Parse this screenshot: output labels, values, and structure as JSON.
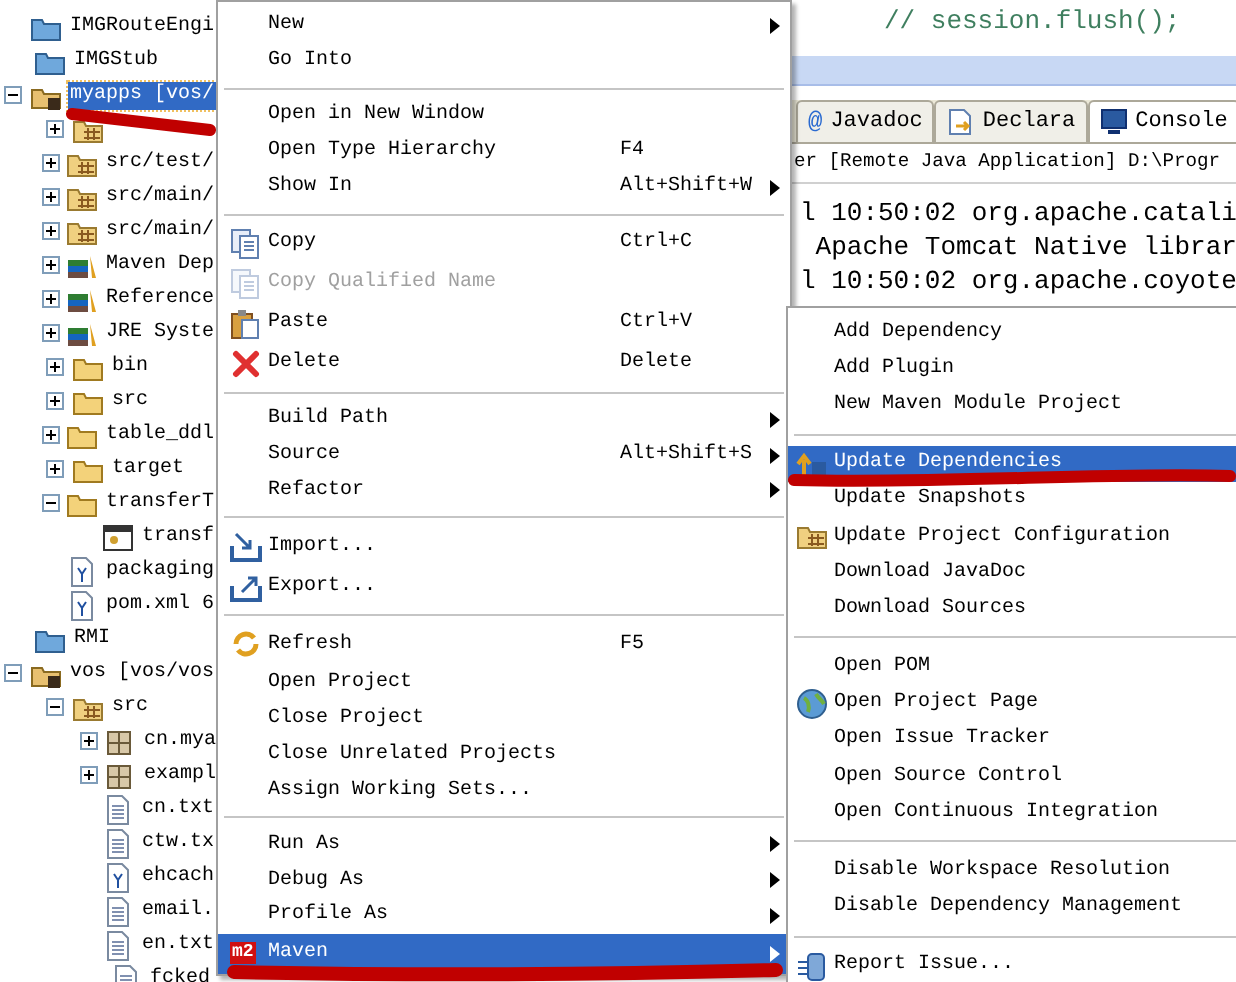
{
  "editor": {
    "code_line": "// session.flush();"
  },
  "console_view": {
    "tabs": [
      {
        "icon_char": "@",
        "label": "Javadoc",
        "kind": "javadoc",
        "selected": false
      },
      {
        "label": "Declara",
        "kind": "declaration",
        "selected": false
      },
      {
        "label": "Console",
        "kind": "console",
        "selected": true
      }
    ],
    "header": "er [Remote Java Application] D:\\Progr",
    "lines": [
      "l 10:50:02 org.apache.catali",
      " Apache Tomcat Native librar",
      "l 10:50:02 org.apache.coyote"
    ]
  },
  "tree": [
    {
      "label": "IMGRouteEngi",
      "kind": "project",
      "selected": false
    },
    {
      "label": "IMGStub",
      "kind": "project",
      "selected": false
    },
    {
      "label": "myapps [vos/",
      "kind": "maven-project",
      "selected": true,
      "expanded": true,
      "children": [
        {
          "kind": "package-folder",
          "selected": false,
          "expanded": false
        },
        {
          "label": "src/test/",
          "kind": "package-folder",
          "selected": false,
          "expanded": false
        },
        {
          "label": "src/main/",
          "kind": "package-folder",
          "selected": false,
          "expanded": false
        },
        {
          "label": "src/main/",
          "kind": "package-folder",
          "selected": false,
          "expanded": false
        },
        {
          "label": "Maven Dep",
          "kind": "library",
          "selected": false,
          "expanded": false
        },
        {
          "label": "Reference",
          "kind": "library",
          "selected": false,
          "expanded": false
        },
        {
          "label": "JRE Syste",
          "kind": "library",
          "selected": false,
          "expanded": false
        },
        {
          "label": "bin",
          "kind": "folder",
          "selected": false,
          "expanded": false
        },
        {
          "label": "src",
          "kind": "folder",
          "selected": false,
          "expanded": false
        },
        {
          "label": "table_ddl",
          "kind": "folder",
          "selected": false,
          "expanded": false
        },
        {
          "label": "target",
          "kind": "folder",
          "selected": false,
          "expanded": false
        },
        {
          "label": "transferT",
          "kind": "folder",
          "selected": false,
          "expanded": true,
          "children": [
            {
              "label": "transf",
              "kind": "window-file",
              "selected": false
            }
          ]
        },
        {
          "label": "packaging",
          "kind": "xml-file",
          "selected": false
        },
        {
          "label": "pom.xml 6",
          "kind": "xml-file",
          "selected": false
        }
      ]
    },
    {
      "label": "RMI",
      "kind": "project",
      "selected": false
    },
    {
      "label": "vos [vos/vos",
      "kind": "maven-project",
      "selected": false,
      "expanded": true,
      "children": [
        {
          "label": "src",
          "kind": "package-folder",
          "selected": false,
          "expanded": true,
          "children": [
            {
              "label": "cn.mya",
              "kind": "package",
              "selected": false,
              "expanded": false
            },
            {
              "label": "exampl",
              "kind": "package",
              "selected": false,
              "expanded": false
            },
            {
              "label": "cn.txt",
              "kind": "file",
              "selected": false
            },
            {
              "label": "ctw.tx",
              "kind": "file",
              "selected": false
            },
            {
              "label": "ehcach",
              "kind": "xml-file",
              "selected": false
            },
            {
              "label": "email.",
              "kind": "file",
              "selected": false
            },
            {
              "label": "en.txt",
              "kind": "file",
              "selected": false
            },
            {
              "label": "fcked",
              "kind": "file",
              "selected": false
            }
          ]
        }
      ]
    }
  ],
  "context_menu": {
    "groups": [
      [
        {
          "label": "New",
          "selected": false,
          "disabled": false,
          "submenu": true
        },
        {
          "label": "Go Into",
          "selected": false,
          "disabled": false,
          "submenu": false
        }
      ],
      [
        {
          "label": "Open in New Window",
          "selected": false,
          "disabled": false,
          "submenu": false
        },
        {
          "label": "Open Type Hierarchy",
          "shortcut": "F4",
          "selected": false,
          "disabled": false,
          "submenu": false
        },
        {
          "label": "Show In",
          "shortcut": "Alt+Shift+W",
          "selected": false,
          "disabled": false,
          "submenu": true
        }
      ],
      [
        {
          "label": "Copy",
          "kind": "copy",
          "shortcut": "Ctrl+C",
          "selected": false,
          "disabled": false,
          "submenu": false
        },
        {
          "label": "Copy Qualified Name",
          "kind": "copy",
          "selected": false,
          "disabled": true,
          "submenu": false
        },
        {
          "label": "Paste",
          "kind": "paste",
          "shortcut": "Ctrl+V",
          "selected": false,
          "disabled": false,
          "submenu": false
        },
        {
          "label": "Delete",
          "kind": "delete",
          "shortcut": "Delete",
          "selected": false,
          "disabled": false,
          "submenu": false
        }
      ],
      [
        {
          "label": "Build Path",
          "selected": false,
          "disabled": false,
          "submenu": true
        },
        {
          "label": "Source",
          "shortcut": "Alt+Shift+S",
          "selected": false,
          "disabled": false,
          "submenu": true
        },
        {
          "label": "Refactor",
          "selected": false,
          "disabled": false,
          "submenu": true
        }
      ],
      [
        {
          "label": "Import...",
          "kind": "import",
          "selected": false,
          "disabled": false,
          "submenu": false
        },
        {
          "label": "Export...",
          "kind": "export",
          "selected": false,
          "disabled": false,
          "submenu": false
        }
      ],
      [
        {
          "label": "Refresh",
          "kind": "refresh",
          "shortcut": "F5",
          "selected": false,
          "disabled": false,
          "submenu": false
        },
        {
          "label": "Open Project",
          "selected": false,
          "disabled": false,
          "submenu": false
        },
        {
          "label": "Close Project",
          "selected": false,
          "disabled": false,
          "submenu": false
        },
        {
          "label": "Close Unrelated Projects",
          "selected": false,
          "disabled": false,
          "submenu": false
        },
        {
          "label": "Assign Working Sets...",
          "selected": false,
          "disabled": false,
          "submenu": false
        }
      ],
      [
        {
          "label": "Run As",
          "selected": false,
          "disabled": false,
          "submenu": true
        },
        {
          "label": "Debug As",
          "selected": false,
          "disabled": false,
          "submenu": true
        },
        {
          "label": "Profile As",
          "selected": false,
          "disabled": false,
          "submenu": true
        },
        {
          "label": "Maven",
          "badge": "m2",
          "selected": true,
          "disabled": false,
          "submenu": true
        }
      ]
    ]
  },
  "maven_submenu": {
    "groups": [
      [
        {
          "label": "Add Dependency",
          "selected": false
        },
        {
          "label": "Add Plugin",
          "selected": false
        },
        {
          "label": "New Maven Module Project",
          "selected": false
        }
      ],
      [
        {
          "label": "Update Dependencies",
          "kind": "update",
          "selected": true
        },
        {
          "label": "Update Snapshots",
          "selected": false
        },
        {
          "label": "Update Project Configuration",
          "kind": "package-folder",
          "selected": false
        },
        {
          "label": "Download JavaDoc",
          "selected": false
        },
        {
          "label": "Download Sources",
          "selected": false
        }
      ],
      [
        {
          "label": "Open POM",
          "selected": false
        },
        {
          "label": "Open Project Page",
          "kind": "globe",
          "selected": false
        },
        {
          "label": "Open Issue Tracker",
          "selected": false
        },
        {
          "label": "Open Source Control",
          "selected": false
        },
        {
          "label": "Open Continuous Integration",
          "selected": false
        }
      ],
      [
        {
          "label": "Disable Workspace Resolution",
          "selected": false
        },
        {
          "label": "Disable Dependency Management",
          "selected": false
        }
      ],
      [
        {
          "label": "Report Issue...",
          "kind": "bug",
          "selected": false
        }
      ]
    ]
  }
}
